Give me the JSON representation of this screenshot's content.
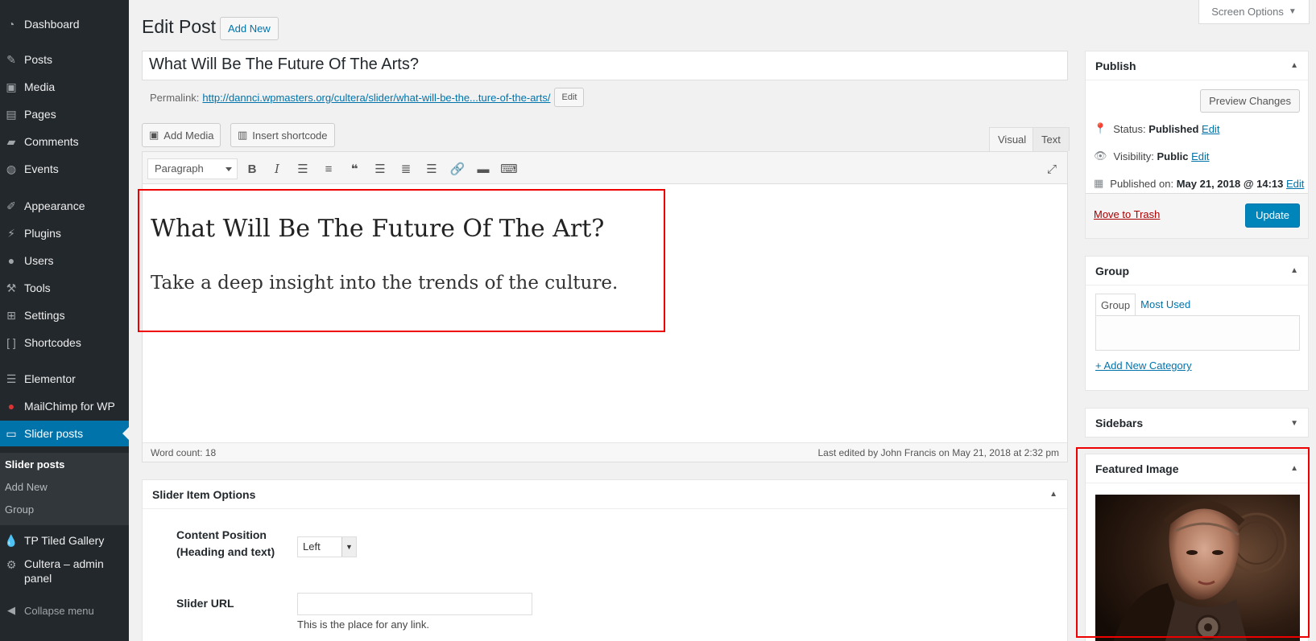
{
  "sidebar": {
    "items": [
      {
        "label": "Dashboard",
        "icon": "dashboard-icon"
      },
      {
        "label": "Posts",
        "icon": "pin-icon"
      },
      {
        "label": "Media",
        "icon": "media-icon"
      },
      {
        "label": "Pages",
        "icon": "pages-icon"
      },
      {
        "label": "Comments",
        "icon": "comment-icon"
      },
      {
        "label": "Events",
        "icon": "events-icon"
      },
      {
        "label": "Appearance",
        "icon": "brush-icon"
      },
      {
        "label": "Plugins",
        "icon": "plug-icon"
      },
      {
        "label": "Users",
        "icon": "user-icon"
      },
      {
        "label": "Tools",
        "icon": "wrench-icon"
      },
      {
        "label": "Settings",
        "icon": "settings-icon"
      },
      {
        "label": "Shortcodes",
        "icon": "brackets-icon"
      },
      {
        "label": "Elementor",
        "icon": "elementor-icon"
      },
      {
        "label": "MailChimp for WP",
        "icon": "mailchimp-icon"
      },
      {
        "label": "Slider posts",
        "icon": "monitor-icon"
      },
      {
        "label": "TP Tiled Gallery",
        "icon": "drop-icon"
      },
      {
        "label": "Cultera – admin panel",
        "icon": "gear-icon"
      },
      {
        "label": "Collapse menu",
        "icon": "collapse-icon"
      }
    ],
    "submenu": [
      "Slider posts",
      "Add New",
      "Group"
    ]
  },
  "header": {
    "title": "Edit Post",
    "add_new": "Add New",
    "screen_options": "Screen Options"
  },
  "post": {
    "title": "What Will Be The Future Of The Arts?",
    "permalink_label": "Permalink:",
    "permalink_url": "http://dannci.wpmasters.org/cultera/slider/what-will-be-the...ture-of-the-arts/",
    "permalink_edit": "Edit"
  },
  "editor": {
    "add_media": "Add Media",
    "insert_shortcode": "Insert shortcode",
    "tab_visual": "Visual",
    "tab_text": "Text",
    "format": "Paragraph",
    "content_heading": "What Will Be The Future Of The Art?",
    "content_sub": "Take a deep insight into the trends of the culture.",
    "word_count": "Word count: 18",
    "last_edited": "Last edited by John Francis on May 21, 2018 at 2:32 pm"
  },
  "slider_options": {
    "title": "Slider Item Options",
    "content_position_label_1": "Content Position",
    "content_position_label_2": "(Heading and text)",
    "content_position_value": "Left",
    "slider_url_label": "Slider URL",
    "slider_url_value": "",
    "slider_url_help": "This is the place for any link."
  },
  "publish": {
    "title": "Publish",
    "preview": "Preview Changes",
    "status_label": "Status:",
    "status_value": "Published",
    "visibility_label": "Visibility:",
    "visibility_value": "Public",
    "published_label": "Published on:",
    "published_value": "May 21, 2018 @ 14:13",
    "edit": "Edit",
    "trash": "Move to Trash",
    "update": "Update"
  },
  "group": {
    "title": "Group",
    "tab_all": "Group",
    "tab_used": "Most Used",
    "add_category": "+ Add New Category"
  },
  "sidebars": {
    "title": "Sidebars"
  },
  "featured": {
    "title": "Featured Image"
  },
  "colors": {
    "sidebar_bg": "#23282d",
    "active": "#0073aa",
    "highlight": "#e00000"
  }
}
